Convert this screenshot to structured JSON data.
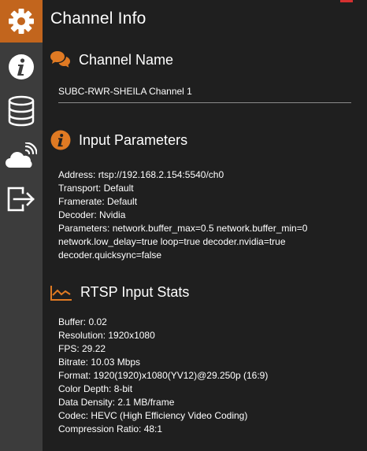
{
  "sidebar": {
    "items": [
      {
        "icon": "gear-icon",
        "active": true
      },
      {
        "icon": "info-icon",
        "active": false
      },
      {
        "icon": "database-icon",
        "active": false
      },
      {
        "icon": "cloud-stream-icon",
        "active": false
      },
      {
        "icon": "export-icon",
        "active": false
      }
    ]
  },
  "header": {
    "title": "Channel Info"
  },
  "channel_name": {
    "heading": "Channel Name",
    "value": "SUBC-RWR-SHEILA Channel 1"
  },
  "input_parameters": {
    "heading": "Input Parameters",
    "lines": [
      "Address: rtsp://192.168.2.154:5540/ch0",
      "Transport: Default",
      "Framerate: Default",
      "Decoder: Nvidia",
      "Parameters: network.buffer_max=0.5 network.buffer_min=0",
      "network.low_delay=true loop=true decoder.nvidia=true",
      "decoder.quicksync=false"
    ]
  },
  "rtsp_stats": {
    "heading": "RTSP Input Stats",
    "lines": [
      "Buffer: 0.02",
      "Resolution: 1920x1080",
      "FPS: 29.22",
      "Bitrate: 10.03 Mbps",
      "Format: 1920(1920)x1080(YV12)@29.250p (16:9)",
      "Color Depth: 8-bit",
      "Data Density: 2.1 MB/frame",
      "Codec: HEVC (High Efficiency Video Coding)",
      "Compression Ratio: 48:1"
    ]
  },
  "colors": {
    "accent": "#c2651d",
    "sidebar_bg": "#3c3c3c",
    "main_bg": "#1f1f1f"
  }
}
